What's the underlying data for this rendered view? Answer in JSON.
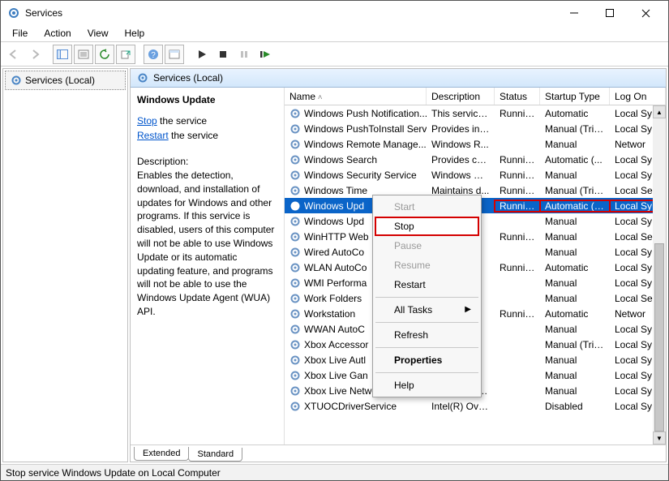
{
  "window": {
    "title": "Services"
  },
  "menubar": [
    "File",
    "Action",
    "View",
    "Help"
  ],
  "left": {
    "item": "Services (Local)"
  },
  "paneHeader": "Services (Local)",
  "detail": {
    "title": "Windows Update",
    "stop_link": "Stop",
    "stop_suffix": " the service",
    "restart_link": "Restart",
    "restart_suffix": " the service",
    "desc_label": "Description:",
    "desc": "Enables the detection, download, and installation of updates for Windows and other programs. If this service is disabled, users of this computer will not be able to use Windows Update or its automatic updating feature, and programs will not be able to use the Windows Update Agent (WUA) API."
  },
  "columns": {
    "name": "Name",
    "desc": "Description",
    "status": "Status",
    "startup": "Startup Type",
    "logon": "Log On"
  },
  "rows": [
    {
      "name": "Windows Push Notification...",
      "desc": "This service ...",
      "status": "Running",
      "startup": "Automatic",
      "logon": "Local Sy"
    },
    {
      "name": "Windows PushToInstall Serv...",
      "desc": "Provides inf...",
      "status": "",
      "startup": "Manual (Trig...",
      "logon": "Local Sy"
    },
    {
      "name": "Windows Remote Manage...",
      "desc": "Windows R...",
      "status": "",
      "startup": "Manual",
      "logon": "Networ"
    },
    {
      "name": "Windows Search",
      "desc": "Provides co...",
      "status": "Running",
      "startup": "Automatic (...",
      "logon": "Local Sy"
    },
    {
      "name": "Windows Security Service",
      "desc": "Windows Se...",
      "status": "Running",
      "startup": "Manual",
      "logon": "Local Sy"
    },
    {
      "name": "Windows Time",
      "desc": "Maintains d...",
      "status": "Running",
      "startup": "Manual (Trig...",
      "logon": "Local Se"
    },
    {
      "name": "Windows Upd",
      "desc": "",
      "status": "Running",
      "startup": "Automatic (T...",
      "logon": "Local Sy",
      "selected": true,
      "highlight": true
    },
    {
      "name": "Windows Upd",
      "desc": "",
      "status": "",
      "startup": "Manual",
      "logon": "Local Sy"
    },
    {
      "name": "WinHTTP Web",
      "desc": "",
      "status": "Running",
      "startup": "Manual",
      "logon": "Local Se"
    },
    {
      "name": "Wired AutoCo",
      "desc": "",
      "status": "",
      "startup": "Manual",
      "logon": "Local Sy"
    },
    {
      "name": "WLAN AutoCo",
      "desc": "",
      "status": "Running",
      "startup": "Automatic",
      "logon": "Local Sy"
    },
    {
      "name": "WMI Performa",
      "desc": "",
      "status": "",
      "startup": "Manual",
      "logon": "Local Sy"
    },
    {
      "name": "Work Folders",
      "desc": "",
      "status": "",
      "startup": "Manual",
      "logon": "Local Se"
    },
    {
      "name": "Workstation",
      "desc": "",
      "status": "Running",
      "startup": "Automatic",
      "logon": "Networ"
    },
    {
      "name": "WWAN AutoC",
      "desc": "",
      "status": "",
      "startup": "Manual",
      "logon": "Local Sy"
    },
    {
      "name": "Xbox Accessor",
      "desc": "",
      "status": "",
      "startup": "Manual (Trig...",
      "logon": "Local Sy"
    },
    {
      "name": "Xbox Live Autl",
      "desc": "",
      "status": "",
      "startup": "Manual",
      "logon": "Local Sy"
    },
    {
      "name": "Xbox Live Gan",
      "desc": "",
      "status": "",
      "startup": "Manual",
      "logon": "Local Sy"
    },
    {
      "name": "Xbox Live Networking Service",
      "desc": "This service ...",
      "status": "",
      "startup": "Manual",
      "logon": "Local Sy"
    },
    {
      "name": "XTUOCDriverService",
      "desc": "Intel(R) Ove...",
      "status": "",
      "startup": "Disabled",
      "logon": "Local Sy"
    }
  ],
  "context": {
    "start": "Start",
    "stop": "Stop",
    "pause": "Pause",
    "resume": "Resume",
    "restart": "Restart",
    "alltasks": "All Tasks",
    "refresh": "Refresh",
    "properties": "Properties",
    "help": "Help"
  },
  "tabs": {
    "extended": "Extended",
    "standard": "Standard"
  },
  "statusbar": "Stop service Windows Update on Local Computer"
}
